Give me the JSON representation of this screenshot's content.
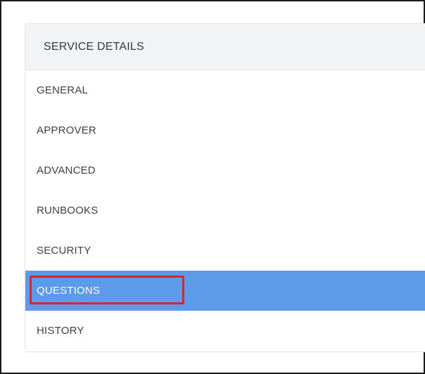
{
  "panel": {
    "header": "SERVICE DETAILS",
    "items": [
      {
        "label": "GENERAL",
        "active": false
      },
      {
        "label": "APPROVER",
        "active": false
      },
      {
        "label": "ADVANCED",
        "active": false
      },
      {
        "label": "RUNBOOKS",
        "active": false
      },
      {
        "label": "SECURITY",
        "active": false
      },
      {
        "label": "QUESTIONS",
        "active": true
      },
      {
        "label": "HISTORY",
        "active": false
      }
    ]
  },
  "colors": {
    "active_background": "#5b9be8",
    "highlight_border": "#d9232e",
    "header_background": "#f1f3f5"
  }
}
